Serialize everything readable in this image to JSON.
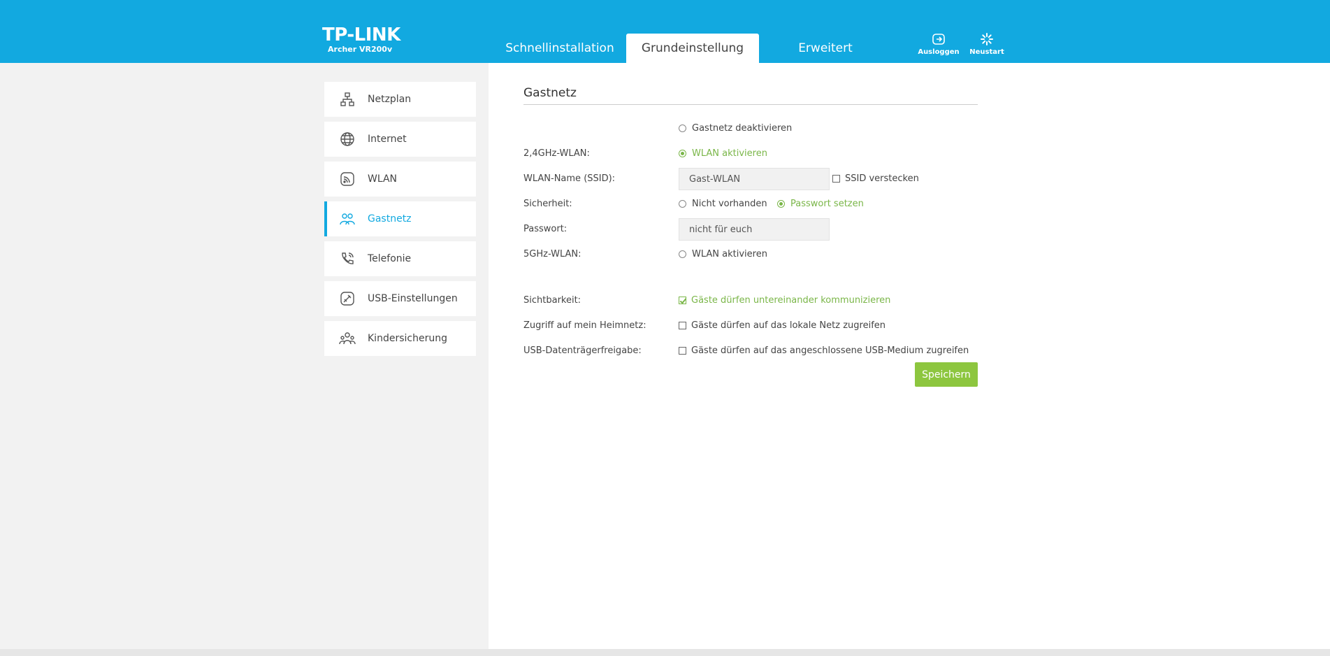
{
  "brand": {
    "logo": "TP-LINK",
    "model": "Archer VR200v"
  },
  "topnav": {
    "tabs": [
      {
        "label": "Schnellinstallation",
        "active": false
      },
      {
        "label": "Grundeinstellung",
        "active": true
      },
      {
        "label": "Erweitert",
        "active": false
      }
    ]
  },
  "toolbar": {
    "logout_label": "Ausloggen",
    "logout_icon": "logout-icon",
    "reboot_label": "Neustart",
    "reboot_icon": "reboot-icon"
  },
  "sidebar": {
    "items": [
      {
        "label": "Netzplan",
        "icon": "network-map-icon",
        "active": false
      },
      {
        "label": "Internet",
        "icon": "globe-icon",
        "active": false
      },
      {
        "label": "WLAN",
        "icon": "wireless-icon",
        "active": false
      },
      {
        "label": "Gastnetz",
        "icon": "guest-network-icon",
        "active": true
      },
      {
        "label": "Telefonie",
        "icon": "phone-icon",
        "active": false
      },
      {
        "label": "USB-Einstellungen",
        "icon": "usb-icon",
        "active": false
      },
      {
        "label": "Kindersicherung",
        "icon": "parental-control-icon",
        "active": false
      }
    ]
  },
  "main": {
    "title": "Gastnetz",
    "disable_option": "Gastnetz deaktivieren",
    "wlan24": {
      "label": "2,4GHz-WLAN:",
      "option": "WLAN aktivieren",
      "checked": true
    },
    "ssid": {
      "label": "WLAN-Name (SSID):",
      "value": "Gast-WLAN",
      "hide_label": "SSID verstecken",
      "hidden": false
    },
    "security": {
      "label": "Sicherheit:",
      "option_none": "Nicht vorhanden",
      "option_password": "Passwort setzen",
      "selected": "password"
    },
    "password": {
      "label": "Passwort:",
      "value": "nicht für euch"
    },
    "wlan5": {
      "label": "5GHz-WLAN:",
      "option": "WLAN aktivieren",
      "checked": false
    },
    "visibility": {
      "label": "Sichtbarkeit:",
      "option": "Gäste dürfen untereinander kommunizieren",
      "checked": true
    },
    "home_access": {
      "label": "Zugriff auf mein Heimnetz:",
      "option": "Gäste dürfen auf das lokale Netz zugreifen",
      "checked": false
    },
    "usb_share": {
      "label": "USB-Datenträgerfreigabe:",
      "option": "Gäste dürfen auf das angeschlossene USB-Medium zugreifen",
      "checked": false
    },
    "save_label": "Speichern"
  },
  "colors": {
    "header": "#12a9e0",
    "accent_green": "#7ab648",
    "button_green": "#8dc63f",
    "sidebar_bg": "#f2f2f2"
  }
}
